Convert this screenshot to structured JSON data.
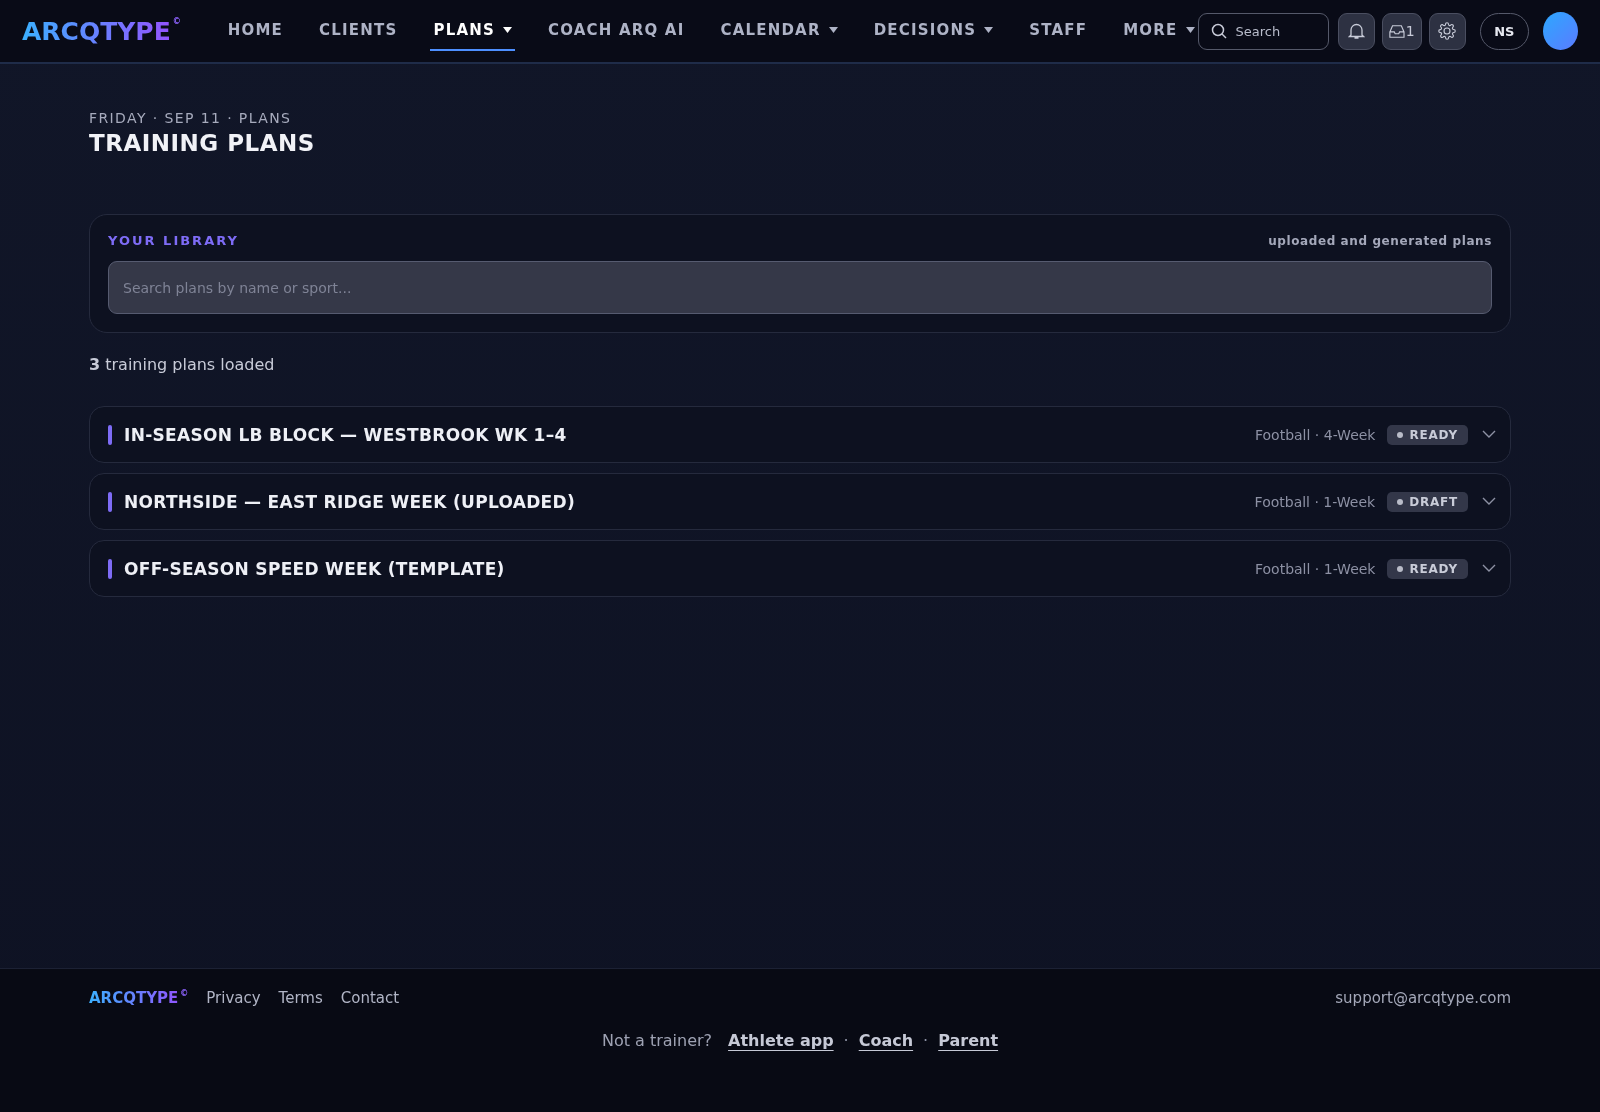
{
  "header": {
    "logo": "ARCQTYPE",
    "logo_mark": "©",
    "nav": [
      {
        "label": "HOME",
        "has_menu": false,
        "selected": false
      },
      {
        "label": "CLIENTS",
        "has_menu": false,
        "selected": false
      },
      {
        "label": "PLANS",
        "has_menu": true,
        "selected": true
      },
      {
        "label": "COACH ARQ AI",
        "has_menu": false,
        "selected": false
      },
      {
        "label": "CALENDAR",
        "has_menu": true,
        "selected": false
      },
      {
        "label": "DECISIONS",
        "has_menu": true,
        "selected": false
      },
      {
        "label": "STAFF",
        "has_menu": false,
        "selected": false
      },
      {
        "label": "MORE",
        "has_menu": true,
        "selected": false
      }
    ],
    "search": {
      "placeholder": "Search"
    },
    "inbox_count": "1",
    "user_initials": "NS"
  },
  "page": {
    "breadcrumb": "FRIDAY · SEP 11 · PLANS",
    "title": "TRAINING PLANS"
  },
  "library": {
    "title": "YOUR LIBRARY",
    "subtitle": "uploaded and generated plans",
    "search": {
      "placeholder": "Search plans by name or sport..."
    }
  },
  "count_text": "**3** training plans loaded",
  "plans": [
    {
      "name": "IN-SEASON LB BLOCK — WESTBROOK WK 1–4",
      "meta": "Football · 4-Week",
      "status": "READY",
      "expanded": false
    },
    {
      "name": "NORTHSIDE — EAST RIDGE WEEK (UPLOADED)",
      "meta": "Football · 1-Week",
      "status": "DRAFT",
      "expanded": false
    },
    {
      "name": "OFF-SEASON SPEED WEEK (TEMPLATE)",
      "meta": "Football · 1-Week",
      "status": "READY",
      "expanded": false
    }
  ],
  "footer": {
    "logo": "ARCQTYPE",
    "logo_mark": "©",
    "links": [
      "Privacy",
      "Terms",
      "Contact"
    ],
    "email": "support@arcqtype.com",
    "prompt": "Not a trainer?",
    "alt_links": [
      "Athlete app",
      "Coach",
      "Parent"
    ],
    "separator": "·"
  }
}
